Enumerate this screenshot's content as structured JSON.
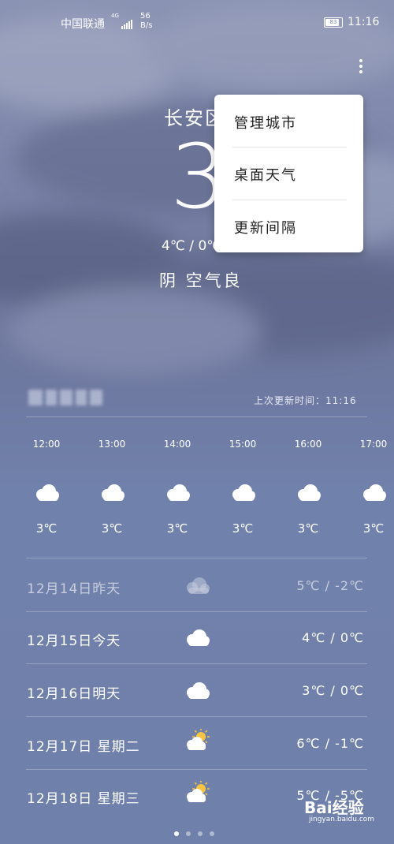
{
  "status_bar": {
    "carrier": "中国联通",
    "network": "4G",
    "speed_value": "56",
    "speed_unit": "B/s",
    "battery": "83",
    "battery_level": 0.83,
    "time": "11:16"
  },
  "current": {
    "city": "长安区",
    "temperature": "3",
    "range": "4℃ / 0℃",
    "condition": "阴 空气良"
  },
  "menu": {
    "items": [
      "管理城市",
      "桌面天气",
      "更新间隔"
    ]
  },
  "update_info": {
    "label": "上次更新时间：",
    "time": "11:16"
  },
  "hourly": [
    {
      "time": "12:00",
      "icon": "cloud-icon",
      "temp": "3℃"
    },
    {
      "time": "13:00",
      "icon": "cloud-icon",
      "temp": "3℃"
    },
    {
      "time": "14:00",
      "icon": "cloud-icon",
      "temp": "3℃"
    },
    {
      "time": "15:00",
      "icon": "cloud-icon",
      "temp": "3℃"
    },
    {
      "time": "16:00",
      "icon": "cloud-icon",
      "temp": "3℃"
    },
    {
      "time": "17:00",
      "icon": "cloud-icon",
      "temp": "3℃"
    }
  ],
  "daily": [
    {
      "date": "12月14日昨天",
      "icon": "cloud-icon",
      "range": "5℃ / -2℃",
      "dim": true
    },
    {
      "date": "12月15日今天",
      "icon": "cloud-icon",
      "range": "4℃ / 0℃",
      "dim": false
    },
    {
      "date": "12月16日明天",
      "icon": "cloud-icon",
      "range": "3℃ / 0℃",
      "dim": false
    },
    {
      "date": "12月17日 星期二",
      "icon": "partly-sunny-icon",
      "range": "6℃ / -1℃",
      "dim": false
    },
    {
      "date": "12月18日 星期三",
      "icon": "partly-sunny-icon",
      "range": "5℃ / -5℃",
      "dim": false
    }
  ],
  "pager": {
    "count": 4,
    "active": 0
  },
  "watermark": {
    "brand": "Bai经验",
    "url": "jingyan.baidu.com"
  }
}
